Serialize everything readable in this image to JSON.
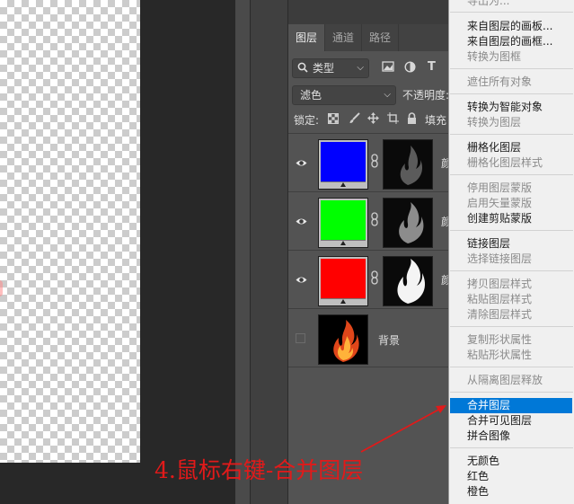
{
  "tabs": [
    {
      "label": "图层"
    },
    {
      "label": "通道"
    },
    {
      "label": "路径"
    }
  ],
  "filter": {
    "kind_label": "类型"
  },
  "blend": {
    "mode": "滤色",
    "opacity_label": "不透明度:"
  },
  "lock": {
    "label": "锁定:",
    "fill_label": "填充"
  },
  "layers": [
    {
      "color": "#0000ff",
      "name_partial": "颜"
    },
    {
      "color": "#00ff00",
      "name_partial": "颜"
    },
    {
      "color": "#ff0000",
      "name_partial": "颜"
    },
    {
      "name": "背景"
    }
  ],
  "menu": {
    "top_cut": "导出为...",
    "items": [
      {
        "label": "来自图层的画板...",
        "disabled": false
      },
      {
        "label": "来自图层的画框...",
        "disabled": false
      },
      {
        "label": "转换为图框",
        "disabled": true
      },
      {
        "label": "遮住所有对象",
        "disabled": true
      },
      {
        "label": "转换为智能对象",
        "disabled": false
      },
      {
        "label": "转换为图层",
        "disabled": true
      },
      {
        "label": "栅格化图层",
        "disabled": false
      },
      {
        "label": "栅格化图层样式",
        "disabled": true
      },
      {
        "label": "停用图层蒙版",
        "disabled": true
      },
      {
        "label": "启用矢量蒙版",
        "disabled": true
      },
      {
        "label": "创建剪贴蒙版",
        "disabled": false
      },
      {
        "label": "链接图层",
        "disabled": false
      },
      {
        "label": "选择链接图层",
        "disabled": true
      },
      {
        "label": "拷贝图层样式",
        "disabled": true
      },
      {
        "label": "粘贴图层样式",
        "disabled": true
      },
      {
        "label": "清除图层样式",
        "disabled": true
      },
      {
        "label": "复制形状属性",
        "disabled": true
      },
      {
        "label": "粘贴形状属性",
        "disabled": true
      },
      {
        "label": "从隔离图层释放",
        "disabled": true
      },
      {
        "label": "合并图层",
        "disabled": false,
        "highlighted": true
      },
      {
        "label": "合并可见图层",
        "disabled": false
      },
      {
        "label": "拼合图像",
        "disabled": false
      },
      {
        "label": "无颜色",
        "disabled": false
      },
      {
        "label": "红色",
        "disabled": false
      },
      {
        "label": "橙色",
        "disabled": false
      }
    ]
  },
  "annotation": {
    "text": "4.鼠标右键-合并图层",
    "color": "#e11a1a"
  }
}
